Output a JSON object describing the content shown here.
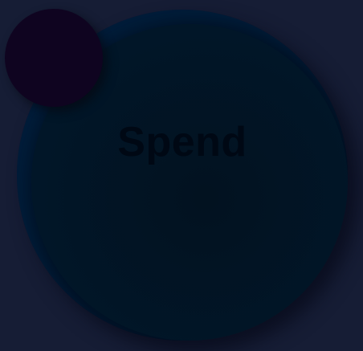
{
  "main": {
    "spend_label": "Spend"
  },
  "colors": {
    "background": "#161d35",
    "button_fill": "#001022",
    "badge_fill": "#0f0420"
  }
}
